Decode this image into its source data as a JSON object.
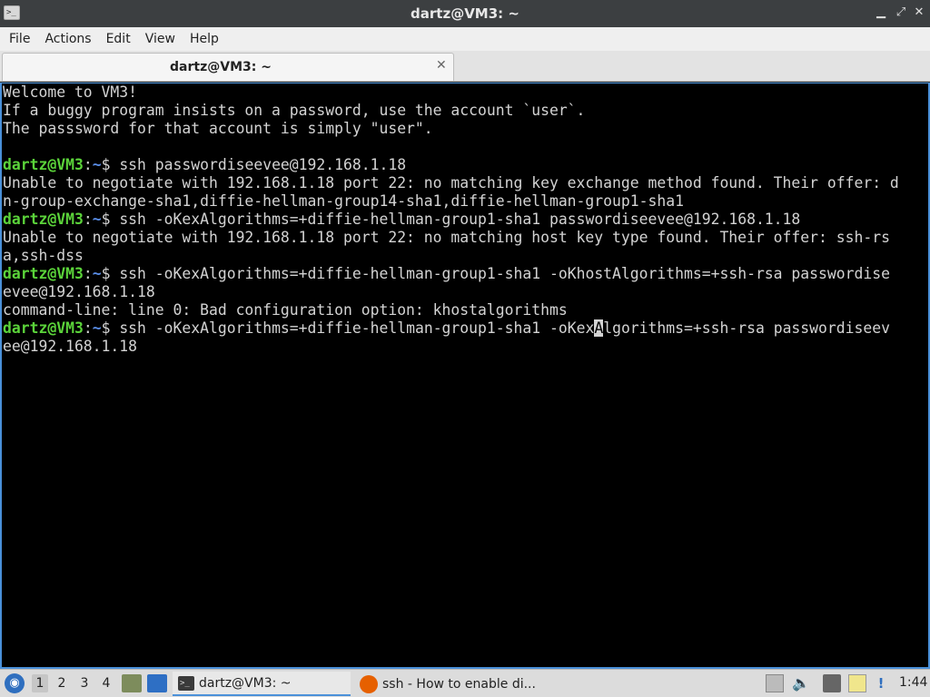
{
  "window": {
    "title": "dartz@VM3: ~",
    "controls": {
      "minimize": "▁",
      "maximize": "⤢",
      "close": "✕"
    }
  },
  "menu": [
    "File",
    "Actions",
    "Edit",
    "View",
    "Help"
  ],
  "tab": {
    "label": "dartz@VM3: ~",
    "close": "✕"
  },
  "prompt": {
    "user": "dartz@VM3",
    "sep": ":",
    "path": "~",
    "symbol": "$ "
  },
  "terminal": {
    "welcome1": "Welcome to VM3!",
    "welcome2": "If a buggy program insists on a password, use the account `user`.",
    "welcome3": "The passsword for that account is simply \"user\".",
    "cmd1": "ssh passwordiseevee@192.168.1.18",
    "out1a": "Unable to negotiate with 192.168.1.18 port 22: no matching key exchange method found. Their offer: d",
    "out1b": "n-group-exchange-sha1,diffie-hellman-group14-sha1,diffie-hellman-group1-sha1",
    "cmd2": "ssh -oKexAlgorithms=+diffie-hellman-group1-sha1 passwordiseevee@192.168.1.18",
    "out2a": "Unable to negotiate with 192.168.1.18 port 22: no matching host key type found. Their offer: ssh-rs",
    "out2b": "a,ssh-dss",
    "cmd3a": "ssh -oKexAlgorithms=+diffie-hellman-group1-sha1 -oKhostAlgorithms=+ssh-rsa passwordise",
    "cmd3b": "evee@192.168.1.18",
    "out3": "command-line: line 0: Bad configuration option: khostalgorithms",
    "cmd4_before": "ssh -oKexAlgorithms=+diffie-hellman-group1-sha1 -oKex",
    "cmd4_cursor": "A",
    "cmd4_after": "lgorithms=+ssh-rsa passwordiseev",
    "cmd4b": "ee@192.168.1.18"
  },
  "taskbar": {
    "workspaces": [
      "1",
      "2",
      "3",
      "4"
    ],
    "tasks": [
      {
        "label": "dartz@VM3: ~",
        "icon": "terminal-icon"
      },
      {
        "label": "ssh - How to enable di...",
        "icon": "firefox-icon"
      }
    ],
    "clock": "1:44",
    "tray_icons": [
      "up-arrow-icon",
      "volume-icon",
      "network-icon",
      "clipboard-icon",
      "update-icon"
    ]
  }
}
